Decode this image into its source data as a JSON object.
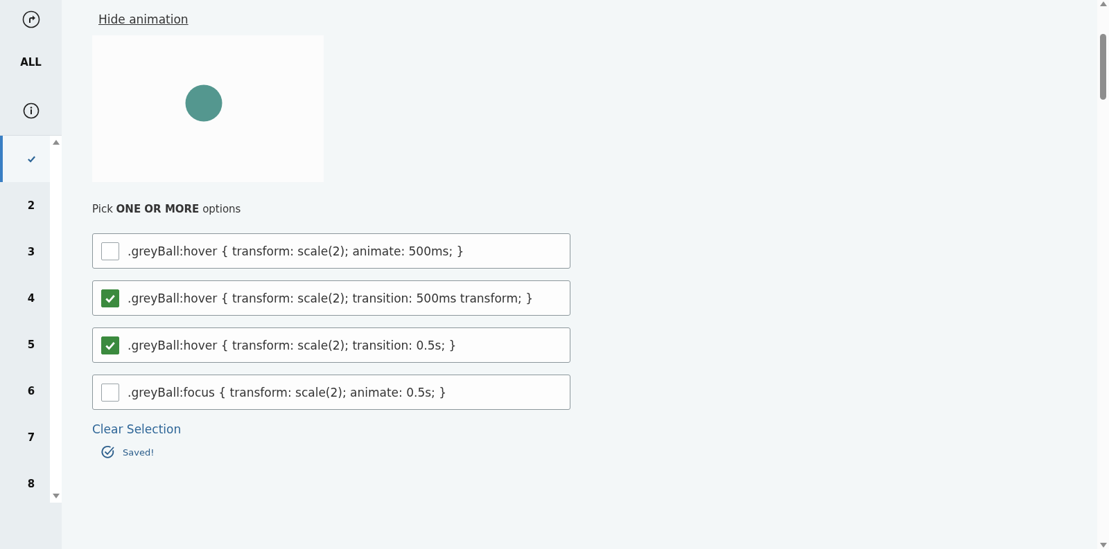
{
  "sidebar": {
    "top_items": [
      {
        "kind": "arrow"
      },
      {
        "kind": "text",
        "label": "ALL"
      },
      {
        "kind": "info"
      }
    ],
    "items": [
      {
        "kind": "done",
        "selected": true
      },
      {
        "kind": "number",
        "label": "2",
        "selected": false
      },
      {
        "kind": "number",
        "label": "3",
        "selected": false
      },
      {
        "kind": "number",
        "label": "4",
        "selected": false
      },
      {
        "kind": "number",
        "label": "5",
        "selected": false
      },
      {
        "kind": "number",
        "label": "6",
        "selected": false
      },
      {
        "kind": "number",
        "label": "7",
        "selected": false
      },
      {
        "kind": "number",
        "label": "8",
        "selected": false
      }
    ]
  },
  "main": {
    "toggle_link": "Hide animation",
    "animation": {
      "kind": "ball"
    },
    "prompt": "Pick **ONE OR MORE** options",
    "options": [
      {
        "text": ".greyBall:hover { transform: scale(2); animate: 500ms; }",
        "checked": false
      },
      {
        "text": ".greyBall:hover { transform: scale(2); transition: 500ms transform; }",
        "checked": true
      },
      {
        "text": ".greyBall:hover { transform: scale(2); transition: 0.5s; }",
        "checked": true
      },
      {
        "text": ".greyBall:focus { transform: scale(2); animate: 0.5s; }",
        "checked": false
      }
    ],
    "clear_link": "Clear Selection",
    "status": "Saved!"
  }
}
